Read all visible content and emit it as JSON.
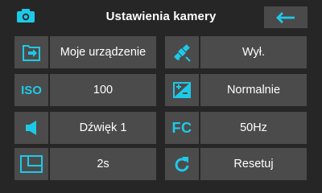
{
  "header": {
    "title": "Ustawienia kamery",
    "left_icon": "camera-icon",
    "back_icon": "arrow-left-icon"
  },
  "accent_color": "#1ec9e8",
  "settings": [
    {
      "icon": "folder-export-icon",
      "value": "Moje urządzenie"
    },
    {
      "icon": "satellite-icon",
      "value": "Wył."
    },
    {
      "icon_text": "ISO",
      "value": "100"
    },
    {
      "icon": "exposure-icon",
      "value": "Normalnie"
    },
    {
      "icon": "speaker-icon",
      "value": "Dźwięk 1"
    },
    {
      "icon_text": "FC",
      "value": "50Hz"
    },
    {
      "icon": "timer-frame-icon",
      "value": "2s"
    },
    {
      "icon": "reset-arrow-icon",
      "value": "Resetuj"
    }
  ]
}
